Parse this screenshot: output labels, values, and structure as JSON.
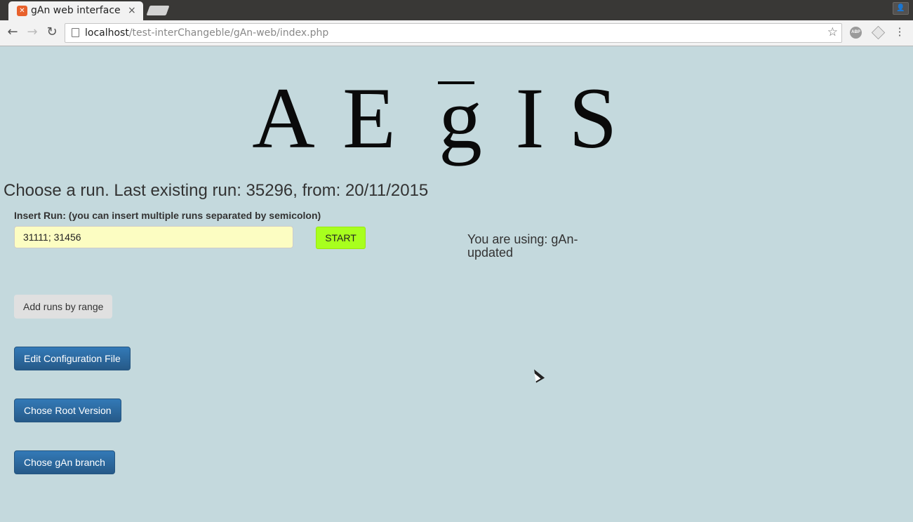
{
  "browser": {
    "tab_title": "gAn web interface",
    "tab_close": "×",
    "favicon": "xampp-icon",
    "url_host": "localhost",
    "url_path": "/test-interChangeble/gAn-web/index.php",
    "abp_label": "ABP"
  },
  "logo": {
    "letters": [
      "A",
      "E",
      "g",
      "I",
      "S"
    ]
  },
  "main": {
    "title": "Choose a run. Last existing run: 35296, from: 20/11/2015",
    "insert_label": "Insert Run: (you can insert multiple runs separated by semicolon)",
    "run_input_value": "31111; 31456",
    "start_label": "START",
    "using_text": "You are using: gAn-updated",
    "add_range_label": "Add runs by range",
    "edit_config_label": "Edit Configuration File",
    "root_version_label": "Chose Root Version",
    "gan_branch_label": "Chose gAn branch"
  },
  "colors": {
    "page_background": "#c4d9dd",
    "start_button": "#a8ff1e",
    "input_background": "#fcfdc2",
    "primary_button": "#2e6da4"
  }
}
